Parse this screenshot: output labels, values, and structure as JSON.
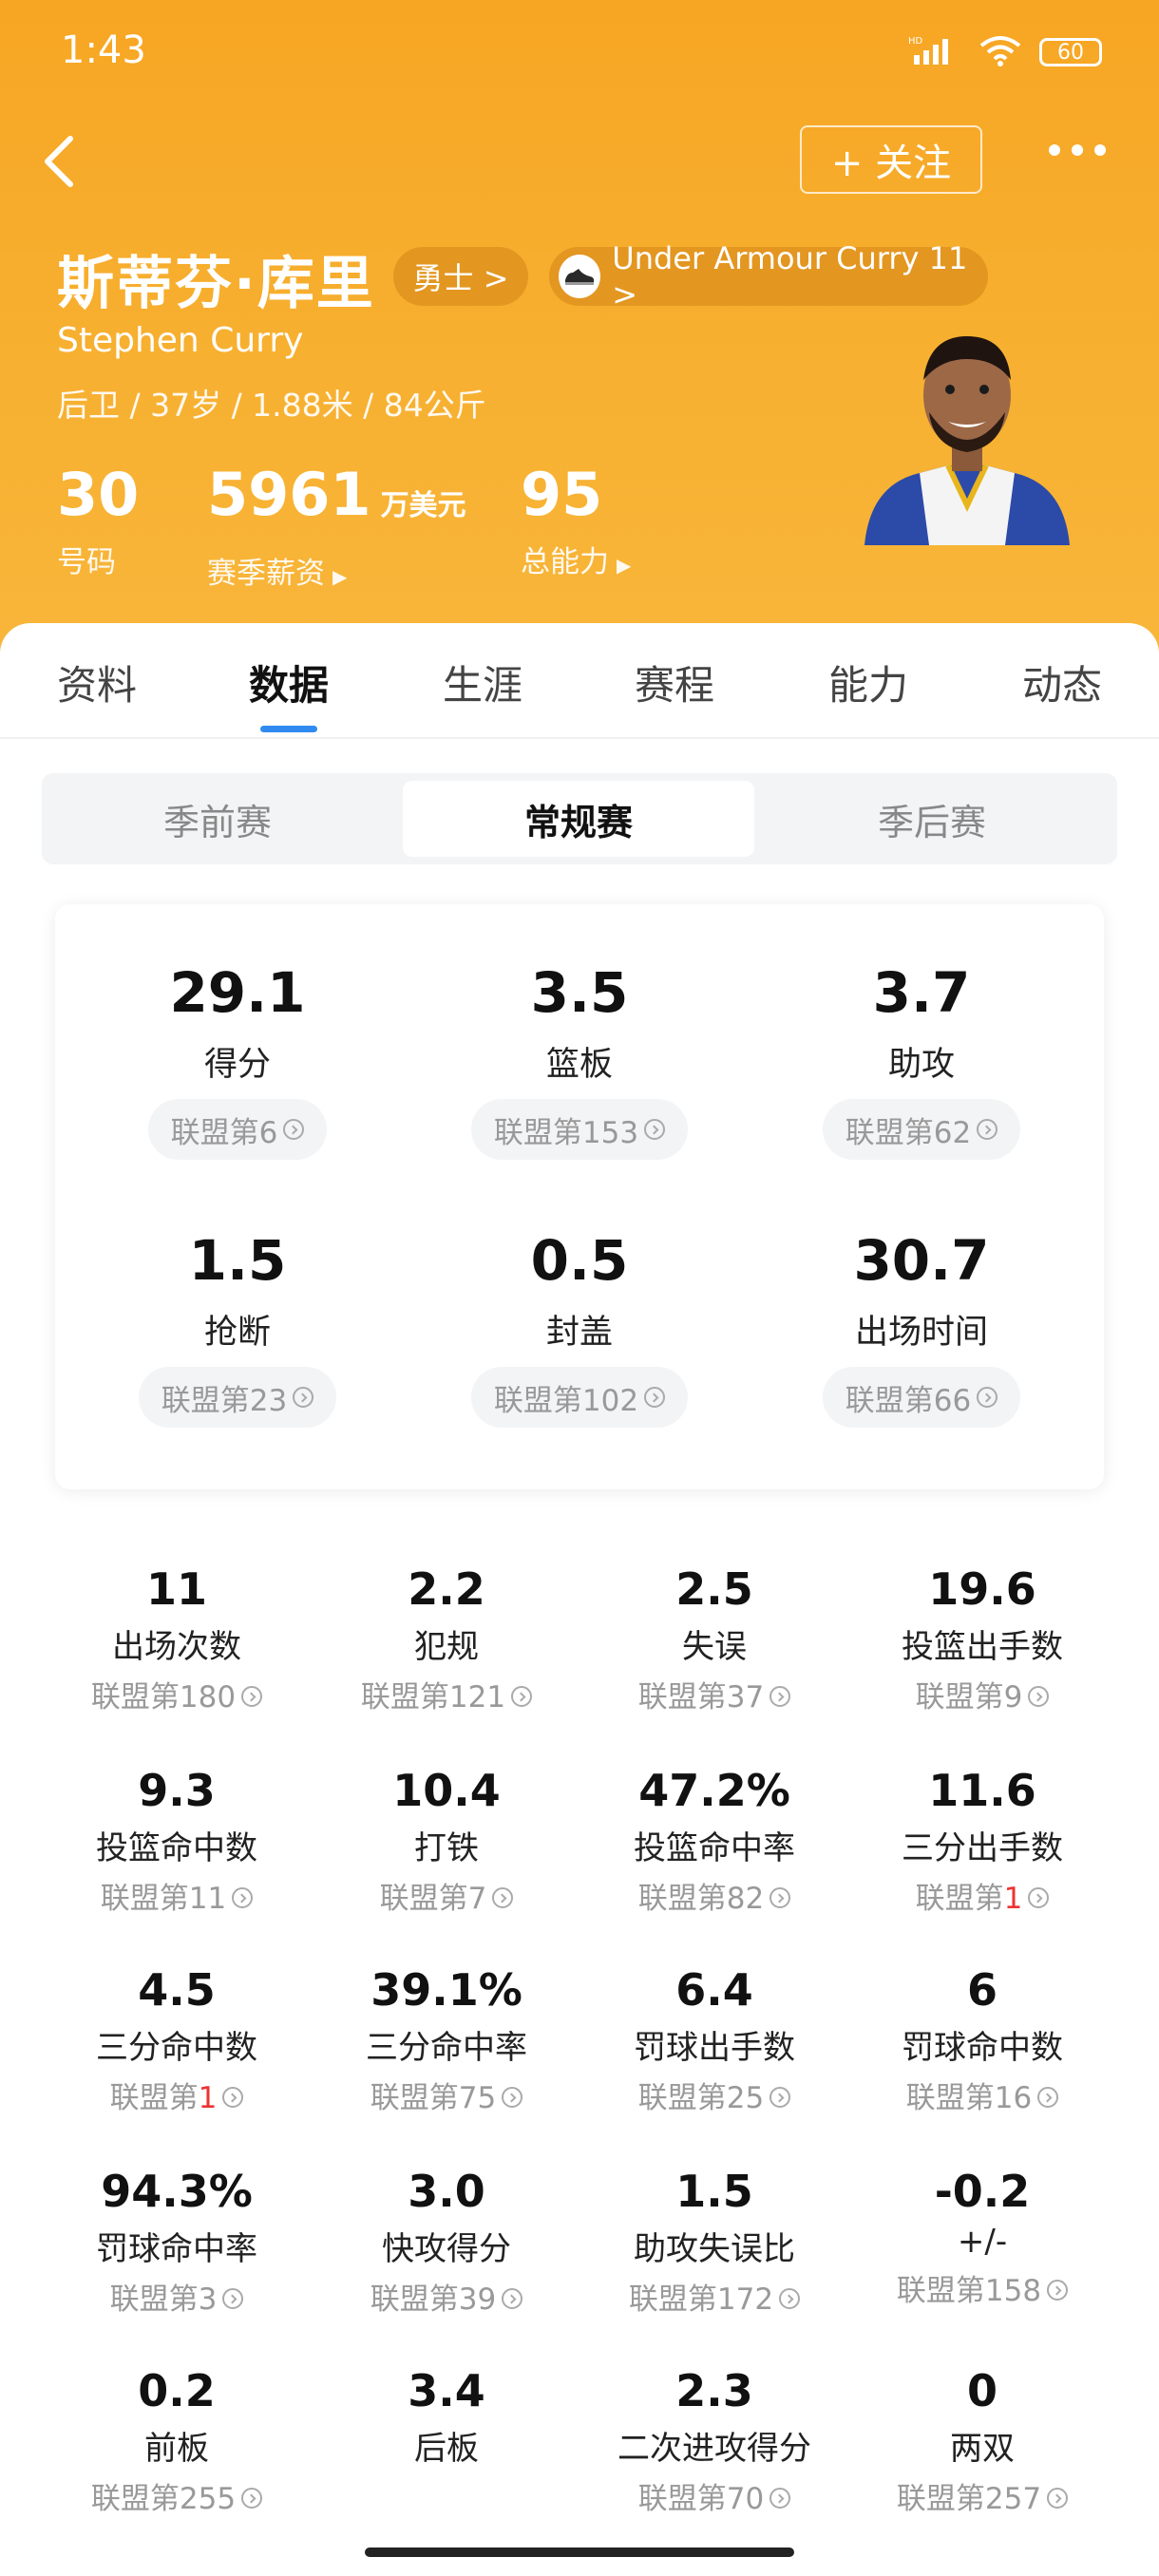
{
  "status_bar": {
    "time": "1:43",
    "network": "HD",
    "battery": "60"
  },
  "header": {
    "follow_label": "+ 关注",
    "name_cn": "斯蒂芬·库里",
    "name_en": "Stephen Curry",
    "team_pill": "勇士 >",
    "shoe_pill": "Under Armour Curry 11 >",
    "profile": "后卫 / 37岁 / 1.88米 / 84公斤",
    "stats": [
      {
        "value": "30",
        "unit": "",
        "label": "号码",
        "arrow": ""
      },
      {
        "value": "5961",
        "unit": "万美元",
        "label": "赛季薪资",
        "arrow": "▶"
      },
      {
        "value": "95",
        "unit": "",
        "label": "总能力",
        "arrow": "▶"
      }
    ]
  },
  "tabs": [
    "资料",
    "数据",
    "生涯",
    "赛程",
    "能力",
    "动态"
  ],
  "active_tab": "数据",
  "segments": [
    "季前赛",
    "常规赛",
    "季后赛"
  ],
  "active_segment": "常规赛",
  "main_stats": [
    {
      "value": "29.1",
      "label": "得分",
      "rank": "联盟第6"
    },
    {
      "value": "3.5",
      "label": "篮板",
      "rank": "联盟第153"
    },
    {
      "value": "3.7",
      "label": "助攻",
      "rank": "联盟第62"
    },
    {
      "value": "1.5",
      "label": "抢断",
      "rank": "联盟第23"
    },
    {
      "value": "0.5",
      "label": "封盖",
      "rank": "联盟第102"
    },
    {
      "value": "30.7",
      "label": "出场时间",
      "rank": "联盟第66"
    }
  ],
  "grid_stats": [
    {
      "value": "11",
      "label": "出场次数",
      "rank_prefix": "联盟第",
      "rank": "180"
    },
    {
      "value": "2.2",
      "label": "犯规",
      "rank_prefix": "联盟第",
      "rank": "121"
    },
    {
      "value": "2.5",
      "label": "失误",
      "rank_prefix": "联盟第",
      "rank": "37"
    },
    {
      "value": "19.6",
      "label": "投篮出手数",
      "rank_prefix": "联盟第",
      "rank": "9"
    },
    {
      "value": "9.3",
      "label": "投篮命中数",
      "rank_prefix": "联盟第",
      "rank": "11"
    },
    {
      "value": "10.4",
      "label": "打铁",
      "rank_prefix": "联盟第",
      "rank": "7"
    },
    {
      "value": "47.2%",
      "label": "投篮命中率",
      "rank_prefix": "联盟第",
      "rank": "82"
    },
    {
      "value": "11.6",
      "label": "三分出手数",
      "rank_prefix": "联盟第",
      "rank": "1",
      "highlight": true
    },
    {
      "value": "4.5",
      "label": "三分命中数",
      "rank_prefix": "联盟第",
      "rank": "1",
      "highlight": true
    },
    {
      "value": "39.1%",
      "label": "三分命中率",
      "rank_prefix": "联盟第",
      "rank": "75"
    },
    {
      "value": "6.4",
      "label": "罚球出手数",
      "rank_prefix": "联盟第",
      "rank": "25"
    },
    {
      "value": "6",
      "label": "罚球命中数",
      "rank_prefix": "联盟第",
      "rank": "16"
    },
    {
      "value": "94.3%",
      "label": "罚球命中率",
      "rank_prefix": "联盟第",
      "rank": "3"
    },
    {
      "value": "3.0",
      "label": "快攻得分",
      "rank_prefix": "联盟第",
      "rank": "39"
    },
    {
      "value": "1.5",
      "label": "助攻失误比",
      "rank_prefix": "联盟第",
      "rank": "172"
    },
    {
      "value": "-0.2",
      "label": "+/-",
      "rank_prefix": "联盟第",
      "rank": "158"
    },
    {
      "value": "0.2",
      "label": "前板",
      "rank_prefix": "联盟第",
      "rank": "255"
    },
    {
      "value": "3.4",
      "label": "后板",
      "rank_prefix": "",
      "rank": ""
    },
    {
      "value": "2.3",
      "label": "二次进攻得分",
      "rank_prefix": "联盟第",
      "rank": "70"
    },
    {
      "value": "0",
      "label": "两双",
      "rank_prefix": "联盟第",
      "rank": "257"
    }
  ],
  "colors": {
    "header": "#f7a623",
    "accent": "#2f8bf0",
    "rank_highlight": "#ee3333"
  }
}
